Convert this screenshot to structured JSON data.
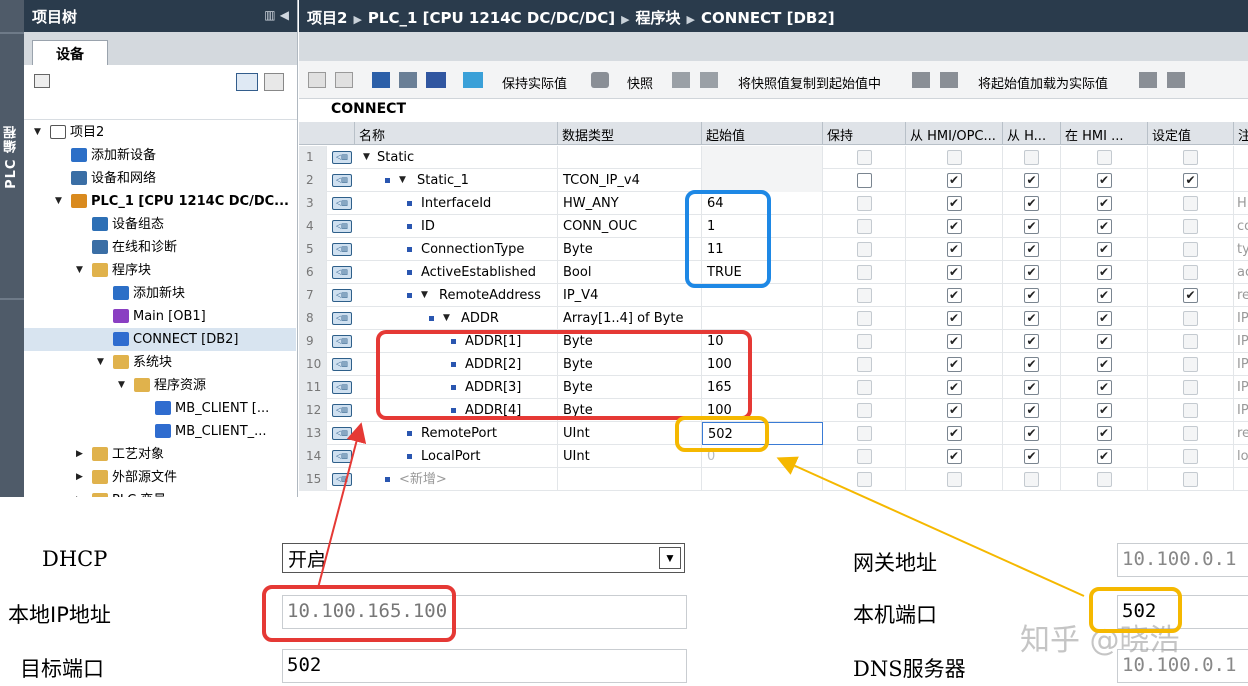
{
  "left_panel": {
    "vertical_label": "PLC 编程",
    "title": "项目树",
    "tab": "设备",
    "tree": [
      {
        "label": "项目2",
        "icon": "project-icon",
        "expanded": true
      },
      {
        "label": "添加新设备",
        "icon": "add-device-icon"
      },
      {
        "label": "设备和网络",
        "icon": "network-icon"
      },
      {
        "label": "PLC_1 [CPU 1214C DC/DC...",
        "icon": "plc-icon",
        "expanded": true
      },
      {
        "label": "设备组态",
        "icon": "device-config-icon"
      },
      {
        "label": "在线和诊断",
        "icon": "diagnostics-icon"
      },
      {
        "label": "程序块",
        "icon": "folder-icon",
        "expanded": true
      },
      {
        "label": "添加新块",
        "icon": "add-block-icon"
      },
      {
        "label": "Main [OB1]",
        "icon": "ob-block-icon"
      },
      {
        "label": "CONNECT [DB2]",
        "icon": "db-block-icon",
        "selected": true
      },
      {
        "label": "系统块",
        "icon": "folder-icon",
        "expanded": true
      },
      {
        "label": "程序资源",
        "icon": "folder-icon",
        "expanded": true
      },
      {
        "label": "MB_CLIENT [...",
        "icon": "fb-block-icon"
      },
      {
        "label": "MB_CLIENT_...",
        "icon": "db-block-icon"
      },
      {
        "label": "工艺对象",
        "icon": "folder-icon",
        "expanded": false
      },
      {
        "label": "外部源文件",
        "icon": "folder-icon",
        "expanded": false
      },
      {
        "label": "PLC 变量",
        "icon": "folder-icon",
        "expanded": false
      }
    ]
  },
  "breadcrumb": [
    "项目2",
    "PLC_1 [CPU 1214C DC/DC/DC]",
    "程序块",
    "CONNECT [DB2]"
  ],
  "toolbar": {
    "keep_actual": "保持实际值",
    "snapshot": "快照",
    "copy_snapshot": "将快照值复制到起始值中",
    "load_start": "将起始值加载为实际值"
  },
  "block_name": "CONNECT",
  "table": {
    "headers": [
      "名称",
      "数据类型",
      "起始值",
      "保持",
      "从 HMI/OPC...",
      "从 H...",
      "在 HMI ...",
      "设定值",
      "注"
    ],
    "rows": [
      {
        "no": "1",
        "name": "Static",
        "type": "",
        "start": "",
        "indent": 0,
        "expand": "down",
        "bullet": false,
        "keep": false,
        "a": false,
        "b": false,
        "c": false,
        "set": false,
        "comment": "",
        "enabled": false
      },
      {
        "no": "2",
        "name": "Static_1",
        "type": "TCON_IP_v4",
        "start": "",
        "indent": 1,
        "expand": "down",
        "bullet": true,
        "keep": false,
        "a": true,
        "b": true,
        "c": true,
        "set": true,
        "comment": "",
        "enabled": true
      },
      {
        "no": "3",
        "name": "InterfaceId",
        "type": "HW_ANY",
        "start": "64",
        "indent": 2,
        "bullet": true,
        "keep": false,
        "a": true,
        "b": true,
        "c": true,
        "set": false,
        "comment": "H",
        "enabled": false
      },
      {
        "no": "4",
        "name": "ID",
        "type": "CONN_OUC",
        "start": "1",
        "indent": 2,
        "bullet": true,
        "keep": false,
        "a": true,
        "b": true,
        "c": true,
        "set": false,
        "comment": "co",
        "enabled": false
      },
      {
        "no": "5",
        "name": "ConnectionType",
        "type": "Byte",
        "start": "11",
        "indent": 2,
        "bullet": true,
        "keep": false,
        "a": true,
        "b": true,
        "c": true,
        "set": false,
        "comment": "ty",
        "enabled": false
      },
      {
        "no": "6",
        "name": "ActiveEstablished",
        "type": "Bool",
        "start": "TRUE",
        "indent": 2,
        "bullet": true,
        "keep": false,
        "a": true,
        "b": true,
        "c": true,
        "set": false,
        "comment": "ac",
        "enabled": false
      },
      {
        "no": "7",
        "name": "RemoteAddress",
        "type": "IP_V4",
        "start": "",
        "indent": 2,
        "expand": "down",
        "bullet": true,
        "keep": false,
        "a": true,
        "b": true,
        "c": true,
        "set": true,
        "comment": "re",
        "enabled": false
      },
      {
        "no": "8",
        "name": "ADDR",
        "type": "Array[1..4] of Byte",
        "start": "",
        "indent": 3,
        "expand": "down",
        "bullet": true,
        "keep": false,
        "a": true,
        "b": true,
        "c": true,
        "set": false,
        "comment": "IP",
        "enabled": false
      },
      {
        "no": "9",
        "name": "ADDR[1]",
        "type": "Byte",
        "start": "10",
        "indent": 4,
        "bullet": true,
        "keep": false,
        "a": true,
        "b": true,
        "c": true,
        "set": false,
        "comment": "IP",
        "enabled": false
      },
      {
        "no": "10",
        "name": "ADDR[2]",
        "type": "Byte",
        "start": "100",
        "indent": 4,
        "bullet": true,
        "keep": false,
        "a": true,
        "b": true,
        "c": true,
        "set": false,
        "comment": "IP",
        "enabled": false
      },
      {
        "no": "11",
        "name": "ADDR[3]",
        "type": "Byte",
        "start": "165",
        "indent": 4,
        "bullet": true,
        "keep": false,
        "a": true,
        "b": true,
        "c": true,
        "set": false,
        "comment": "IP",
        "enabled": false
      },
      {
        "no": "12",
        "name": "ADDR[4]",
        "type": "Byte",
        "start": "100",
        "indent": 4,
        "bullet": true,
        "keep": false,
        "a": true,
        "b": true,
        "c": true,
        "set": false,
        "comment": "IP",
        "enabled": false
      },
      {
        "no": "13",
        "name": "RemotePort",
        "type": "UInt",
        "start": "502",
        "indent": 2,
        "bullet": true,
        "keep": false,
        "a": true,
        "b": true,
        "c": true,
        "set": false,
        "comment": "re",
        "enabled": false,
        "editing": true
      },
      {
        "no": "14",
        "name": "LocalPort",
        "type": "UInt",
        "start": "0",
        "indent": 2,
        "bullet": true,
        "keep": false,
        "a": true,
        "b": true,
        "c": true,
        "set": false,
        "comment": "lo",
        "enabled": false,
        "grey_start": true
      },
      {
        "no": "15",
        "name": "<新增>",
        "type": "",
        "start": "",
        "indent": 1,
        "bullet": true,
        "keep": false,
        "a": false,
        "b": false,
        "c": false,
        "set": false,
        "comment": "",
        "enabled": false,
        "placeholder": true
      }
    ]
  },
  "form": {
    "dhcp_label": "DHCP",
    "dhcp_value": "开启",
    "local_ip_label": "本地IP地址",
    "local_ip_value": "10.100.165.100",
    "target_port_label": "目标端口",
    "target_port_value": "502",
    "gateway_label": "网关地址",
    "gateway_value": "10.100.0.1",
    "local_port_label": "本机端口",
    "local_port_value": "502",
    "dns_label": "DNS服务器",
    "dns_value": "10.100.0.1"
  },
  "watermark": "知乎 @晓浩",
  "colors": {
    "header_bg": "#2a3b4c",
    "highlight_blue": "#1e88e5",
    "highlight_red": "#e53935",
    "highlight_yellow": "#f5b800",
    "selected_row": "#d8e4f0"
  }
}
